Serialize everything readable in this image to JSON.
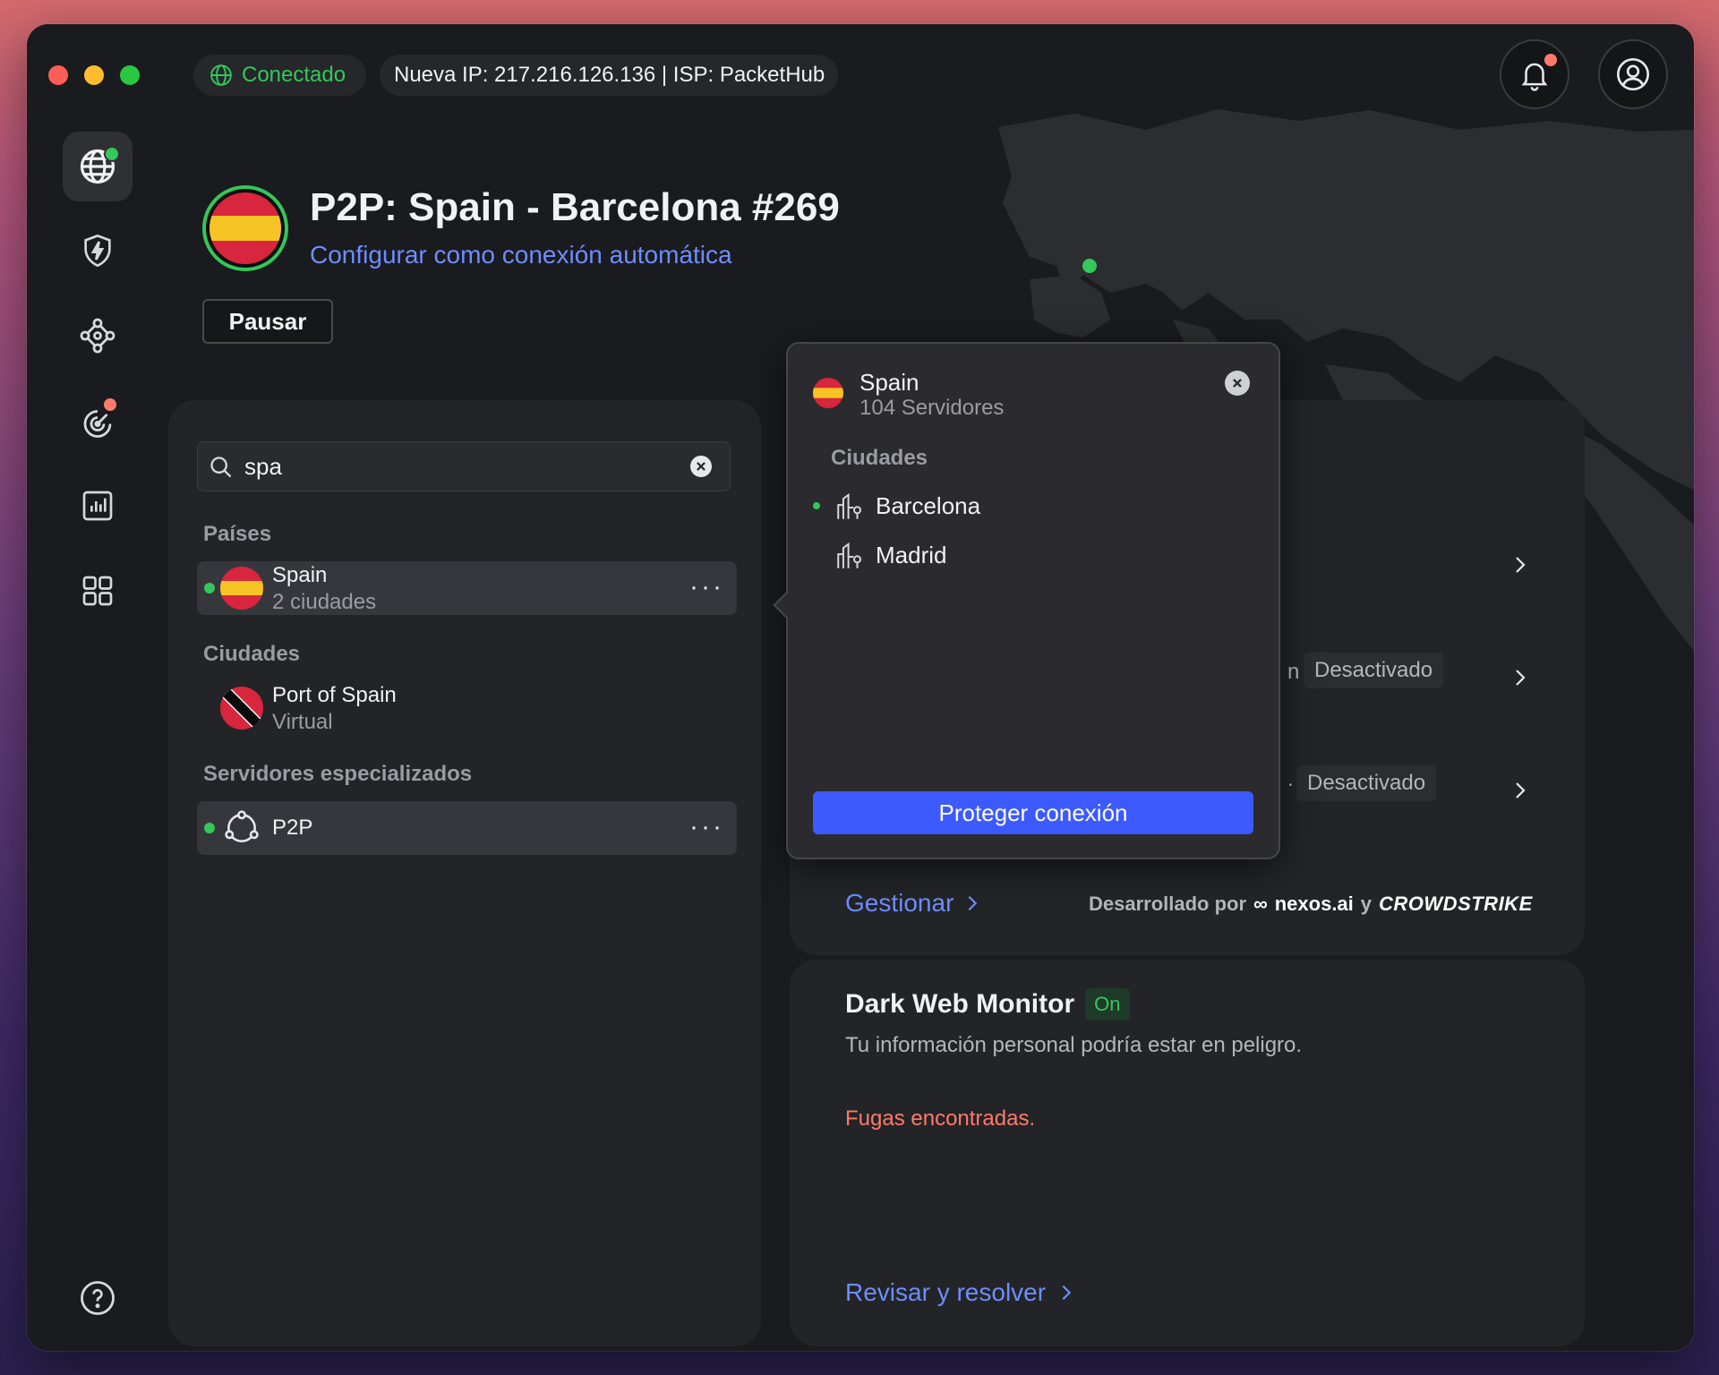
{
  "status": {
    "connected_label": "Conectado",
    "ip_info": "Nueva IP: 217.216.126.136 | ISP: PacketHub"
  },
  "header": {
    "title": "P2P: Spain - Barcelona #269",
    "autoconnect_link": "Configurar como conexión automática",
    "pause_button": "Pausar"
  },
  "search": {
    "value": "spa",
    "placeholder": ""
  },
  "results": {
    "countries_heading": "Países",
    "country": {
      "name": "Spain",
      "sub": "2 ciudades",
      "more": "···"
    },
    "cities_heading": "Ciudades",
    "city": {
      "name": "Port of Spain",
      "sub": "Virtual"
    },
    "specialized_heading": "Servidores especializados",
    "specialized": {
      "name": "P2P",
      "more": "···"
    }
  },
  "popover": {
    "country": "Spain",
    "servers": "104 Servidores",
    "cities_heading": "Ciudades",
    "cities": [
      {
        "name": "Barcelona"
      },
      {
        "name": "Madrid"
      }
    ],
    "protect_button": "Proteger conexión"
  },
  "threat_card": {
    "row2_partial": "n",
    "row2_badge": "Desactivado",
    "row3_partial": ".",
    "row3_badge": "Desactivado",
    "manage_link": "Gestionar",
    "developed_by": "Desarrollado por",
    "partner1": "nexos.ai",
    "conjunction": "y",
    "partner2": "CROWDSTRIKE"
  },
  "dark_web": {
    "title": "Dark Web Monitor",
    "badge": "On",
    "description": "Tu información personal podría estar en peligro.",
    "alert": "Fugas encontradas.",
    "link": "Revisar y resolver"
  },
  "colors": {
    "accent_blue": "#3d5afe",
    "link_blue": "#6e8dff",
    "green": "#34c759",
    "alert_red": "#ff7a6b",
    "spain_red": "#d7263d",
    "spain_yellow": "#f6c324"
  },
  "icons": {
    "sidebar": [
      "globe-icon",
      "shield-bolt-icon",
      "meshnet-icon",
      "radar-icon",
      "stats-icon",
      "apps-grid-icon",
      "help-icon"
    ],
    "top": [
      "bell-icon",
      "user-icon"
    ]
  }
}
